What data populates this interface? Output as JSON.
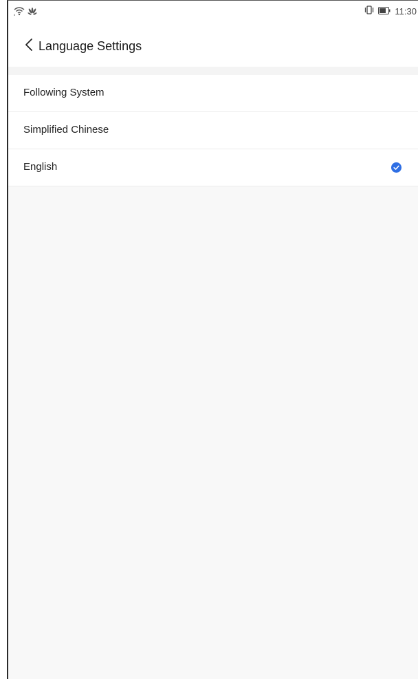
{
  "status_bar": {
    "time": "11:30",
    "left_icons": [
      "wifi-icon",
      "huawei-logo-icon"
    ],
    "right_icons": [
      "vibrate-icon",
      "battery-icon"
    ]
  },
  "header": {
    "back_icon": "chevron-left-icon",
    "title": "Language Settings"
  },
  "language_options": [
    {
      "label": "Following System",
      "selected": false
    },
    {
      "label": "Simplified Chinese",
      "selected": false
    },
    {
      "label": "English",
      "selected": true
    }
  ],
  "colors": {
    "accent": "#2f6fe4",
    "background": "#f8f8f8",
    "surface": "#ffffff",
    "text": "#222222"
  }
}
